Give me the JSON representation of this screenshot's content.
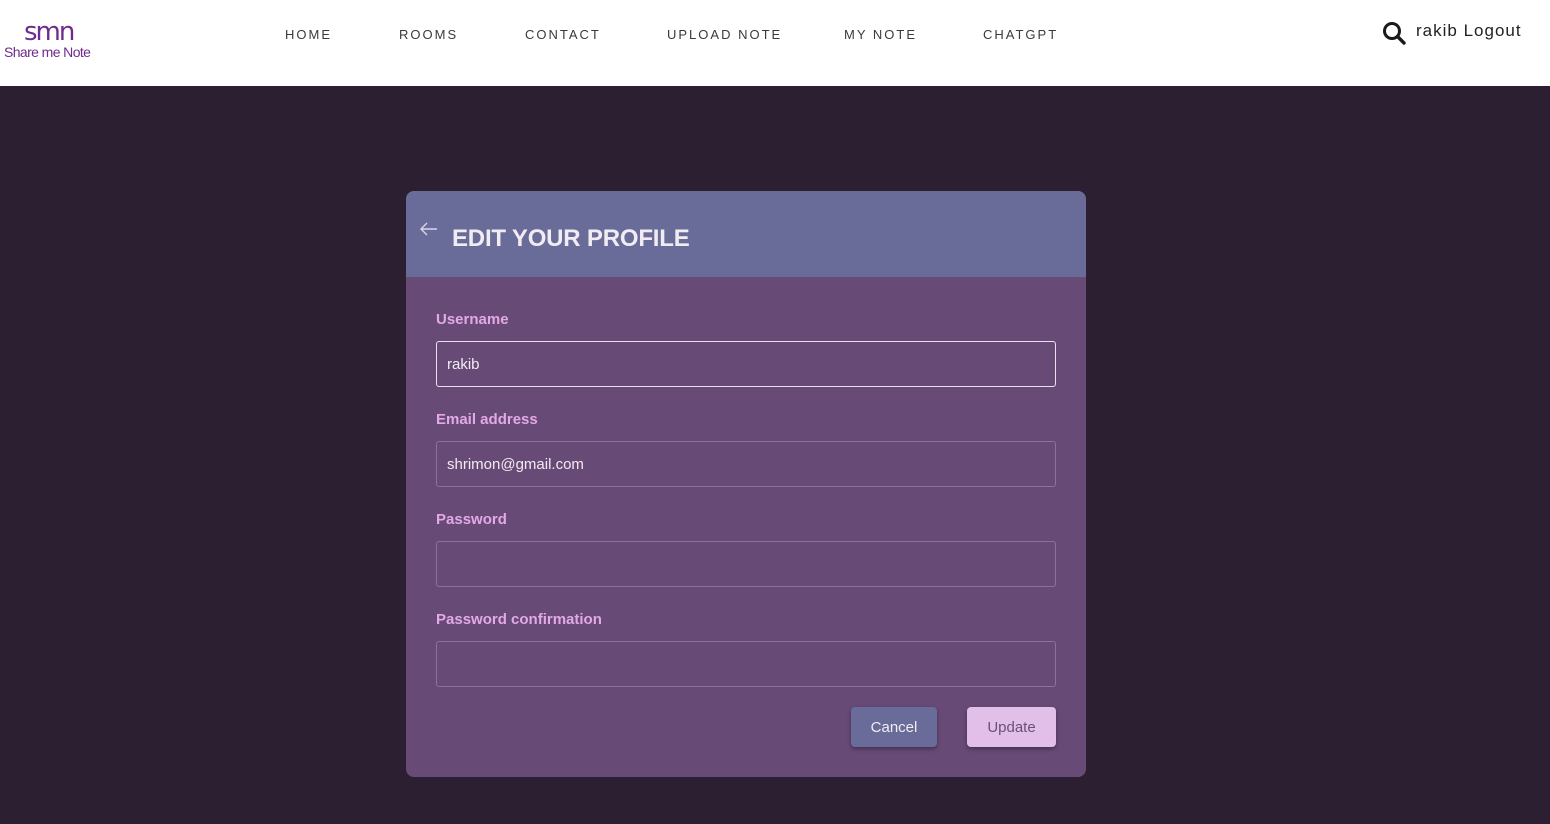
{
  "brand": {
    "logo_mark": "smn",
    "logo_text": "Share me Note",
    "accent_color": "#6f2c8c"
  },
  "nav": {
    "items": [
      {
        "label": "HOME"
      },
      {
        "label": "ROOMS"
      },
      {
        "label": "CONTACT"
      },
      {
        "label": "UPLOAD NOTE"
      },
      {
        "label": "MY NOTE"
      },
      {
        "label": "CHATGPT"
      }
    ]
  },
  "user": {
    "search_icon": "search-icon",
    "username": "rakib",
    "logout_label": "Logout"
  },
  "profile_form": {
    "title": "EDIT YOUR PROFILE",
    "back_icon": "arrow-left-icon",
    "fields": [
      {
        "label": "Username",
        "value": "rakib"
      },
      {
        "label": "Email address",
        "value": "shrimon@gmail.com"
      },
      {
        "label": "Password",
        "value": ""
      },
      {
        "label": "Password confirmation",
        "value": ""
      }
    ],
    "cancel_label": "Cancel",
    "update_label": "Update"
  },
  "colors": {
    "page_background": "#2b1f31",
    "card_header": "#696b98",
    "card_body": "#684a77",
    "label": "#e3a9e6",
    "update_button": "#e2bfe8"
  }
}
